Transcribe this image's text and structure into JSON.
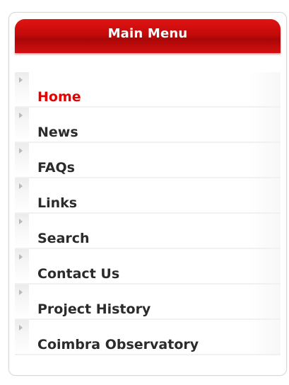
{
  "module": {
    "title": "Main Menu",
    "accent_color": "#d00000"
  },
  "menu": {
    "active_item": "Home",
    "items": [
      {
        "label": "Home",
        "icon": "arrow-right-icon"
      },
      {
        "label": "News",
        "icon": "arrow-right-icon"
      },
      {
        "label": "FAQs",
        "icon": "arrow-right-icon"
      },
      {
        "label": "Links",
        "icon": "arrow-right-icon"
      },
      {
        "label": "Search",
        "icon": "arrow-right-icon"
      },
      {
        "label": "Contact Us",
        "icon": "arrow-right-icon"
      },
      {
        "label": "Project History",
        "icon": "arrow-right-icon"
      },
      {
        "label": "Coimbra Observatory",
        "icon": "arrow-right-icon"
      }
    ]
  }
}
